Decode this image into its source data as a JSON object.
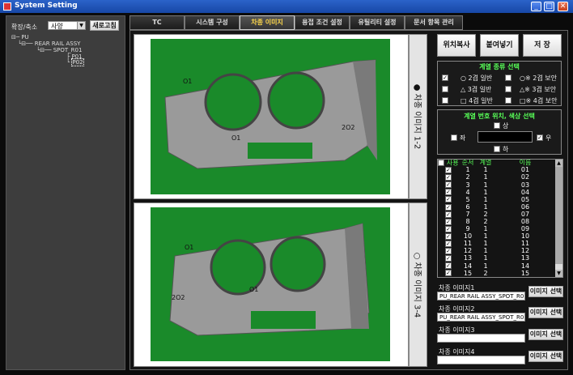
{
  "window": {
    "title": "System Setting",
    "min_label": "_",
    "max_label": "□",
    "close_label": "✕"
  },
  "left": {
    "zoom_label": "확장/축소",
    "zoom_value": "사양",
    "refresh_label": "새로고침",
    "tree": [
      "PU",
      "REAR RAIL ASSY",
      "SPOT_R01",
      "P01",
      "P02"
    ]
  },
  "tabs": [
    "TC",
    "시스템 구성",
    "차종 이미지",
    "용접 조건 설정",
    "유틸리티 설정",
    "문서 항목 관리"
  ],
  "images": {
    "pane1_label": "● 차종 이미지 1-2",
    "pane2_label": "○ 차종 이미지 3-4"
  },
  "right": {
    "copy_pos": "위치복사",
    "paste": "붙여넣기",
    "save": "저 장",
    "series_title": "계열 종류 선택",
    "series_opts": [
      "○ 2겹 일반",
      "○※ 2겹 보안",
      "△ 3겹 일반",
      "△※ 3겹 보안",
      "□ 4겹 일반",
      "□※ 4겹 보안"
    ],
    "pos_title": "계열 번호 위치, 색상 선택",
    "pos_up": "상",
    "pos_left": "좌",
    "pos_right": "우",
    "pos_down": "하",
    "table_headers": [
      "사용",
      "순서",
      "계열",
      "이름"
    ],
    "table_rows": [
      [
        "1",
        "1",
        "01"
      ],
      [
        "2",
        "1",
        "02"
      ],
      [
        "3",
        "1",
        "03"
      ],
      [
        "4",
        "1",
        "04"
      ],
      [
        "5",
        "1",
        "05"
      ],
      [
        "6",
        "1",
        "06"
      ],
      [
        "7",
        "2",
        "07"
      ],
      [
        "8",
        "2",
        "08"
      ],
      [
        "9",
        "1",
        "09"
      ],
      [
        "10",
        "1",
        "10"
      ],
      [
        "11",
        "1",
        "11"
      ],
      [
        "12",
        "1",
        "12"
      ],
      [
        "13",
        "1",
        "13"
      ],
      [
        "14",
        "1",
        "14"
      ],
      [
        "15",
        "2",
        "15"
      ]
    ],
    "img_fields": [
      {
        "label": "차종 이미지1",
        "value": "PU_REAR RAIL ASSY_SPOT_R01_",
        "button": "이미지 선택"
      },
      {
        "label": "차종 이미지2",
        "value": "PU_REAR RAIL ASSY_SPOT_R01_",
        "button": "이미지 선택"
      },
      {
        "label": "차종 이미지3",
        "value": "",
        "button": "이미지 선택"
      },
      {
        "label": "차종 이미지4",
        "value": "",
        "button": "이미지 선택"
      }
    ]
  }
}
